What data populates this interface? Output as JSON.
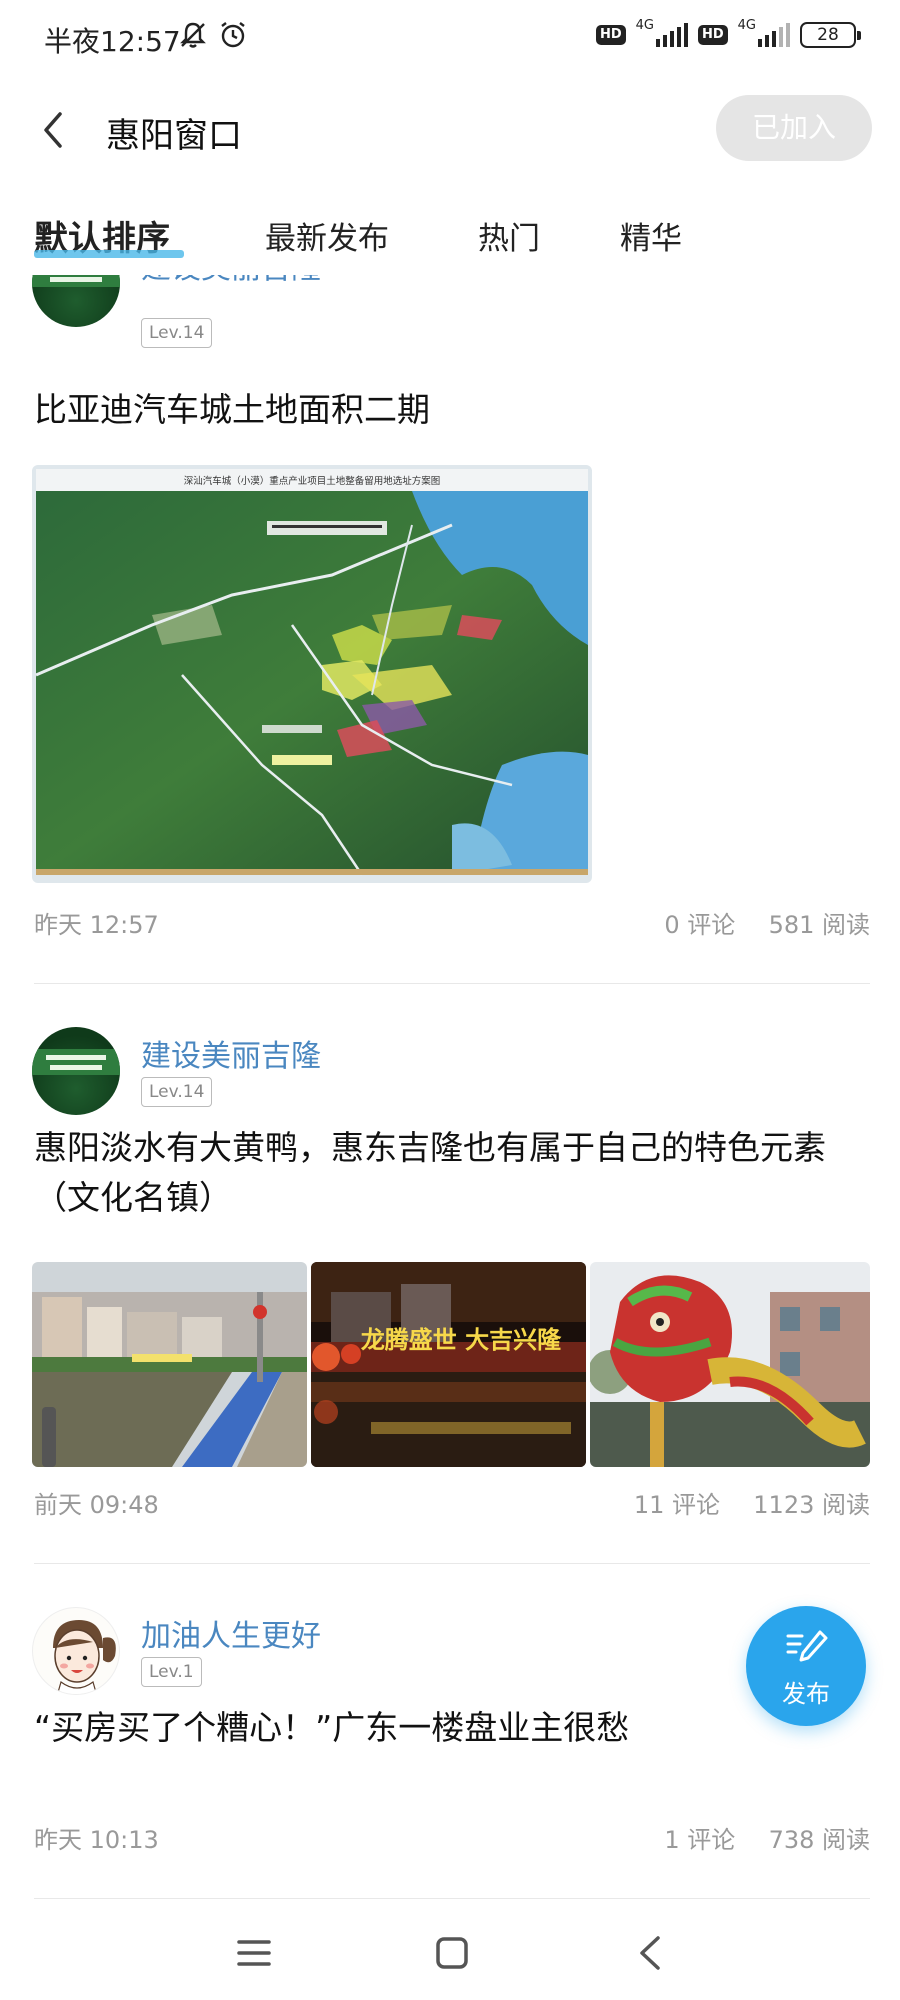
{
  "status_bar": {
    "time": "半夜12:57",
    "network_1": "4G",
    "network_2": "4G",
    "hd_label": "HD",
    "battery": "28"
  },
  "header": {
    "title": "惠阳窗口",
    "join_button": "已加入"
  },
  "tabs": [
    {
      "label": "默认排序",
      "active": true
    },
    {
      "label": "最新发布",
      "active": false
    },
    {
      "label": "热门",
      "active": false
    },
    {
      "label": "精华",
      "active": false
    }
  ],
  "posts": [
    {
      "author": "建设美丽吉隆",
      "level": "Lev.14",
      "title": "比亚迪汽车城土地面积二期",
      "image_caption": "深汕汽车城（小漠）重点产业项目土地整备留用地选址方案图",
      "time": "昨天 12:57",
      "comments": "0 评论",
      "reads": "581 阅读"
    },
    {
      "author": "建设美丽吉隆",
      "level": "Lev.14",
      "title": "惠阳淡水有大黄鸭，惠东吉隆也有属于自己的特色元素（文化名镇）",
      "image_caption": "龙腾盛世 大吉兴隆",
      "time": "前天 09:48",
      "comments": "11 评论",
      "reads": "1123 阅读"
    },
    {
      "author": "加油人生更好",
      "level": "Lev.1",
      "title": "“买房买了个糟心！”广东一楼盘业主很愁",
      "time": "昨天 10:13",
      "comments": "1 评论",
      "reads": "738 阅读"
    }
  ],
  "fab": {
    "label": "发布"
  },
  "colors": {
    "accent": "#2aa5ec",
    "username": "#4a87c0",
    "meta": "#999999",
    "tab_underline": "#4ab8e8"
  },
  "icons": {
    "status": [
      "bell-off-icon",
      "alarm-icon",
      "signal-icon",
      "battery-icon"
    ],
    "header": [
      "back-arrow-icon"
    ],
    "fab": "pencil-edit-icon",
    "nav": [
      "menu-icon",
      "home-square-icon",
      "back-triangle-icon"
    ]
  }
}
